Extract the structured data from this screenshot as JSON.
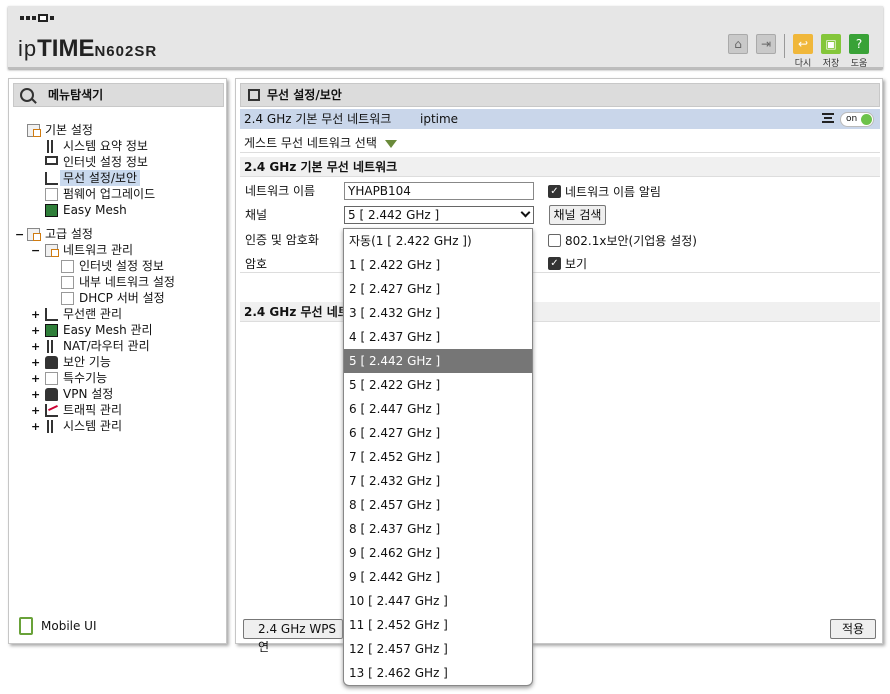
{
  "header": {
    "brand_pre": "ip",
    "brand_bold": "TIME",
    "model": "N602SR",
    "actions": [
      {
        "label": "다시",
        "icon": "undo-icon"
      },
      {
        "label": "저장",
        "icon": "save-icon"
      },
      {
        "label": "도움",
        "icon": "help-icon"
      }
    ],
    "accent": "#84c63a"
  },
  "left": {
    "title": "메뉴탐색기",
    "mobile": "Mobile UI",
    "basic": {
      "label": "기본 설정",
      "items": [
        "시스템 요약 정보",
        "인터넷 설정 정보",
        "무선 설정/보안",
        "펌웨어 업그레이드",
        "Easy Mesh"
      ]
    },
    "advanced": {
      "label": "고급 설정",
      "network": "네트워크 관리",
      "network_sub": [
        "인터넷 설정 정보",
        "내부 네트워크 설정",
        "DHCP 서버 설정"
      ],
      "others": [
        "무선랜 관리",
        "Easy Mesh 관리",
        "NAT/라우터 관리",
        "보안 기능",
        "특수기능",
        "VPN 설정",
        "트래픽 관리",
        "시스템 관리"
      ]
    }
  },
  "main": {
    "title": "무선 설정/보안",
    "band_label": "2.4 GHz 기본 무선 네트워크",
    "band_ssid": "iptime",
    "toggle": "on",
    "guest": "게스트 무선 네트워크 선택",
    "section1": "2.4 GHz 기본 무선 네트워크",
    "name_label": "네트워크 이름",
    "name_value": "YHAPB104",
    "broadcast": "네트워크 이름 알림",
    "channel_label": "채널",
    "channel_value": "5 [ 2.442 GHz ]",
    "scan": "채널 검색",
    "auth_label": "인증 및 암호화",
    "dot1x": "802.1x보안(기업용 설정)",
    "pw_label": "암호",
    "show": "보기",
    "section2": "2.4 GHz 무선 네트",
    "wps": "2.4 GHz WPS연",
    "apply": "적용"
  },
  "dropdown": {
    "selected_index": 5,
    "options": [
      "자동(1 [ 2.422 GHz ])",
      "1 [ 2.422 GHz ]",
      "2 [ 2.427 GHz ]",
      "3 [ 2.432 GHz ]",
      "4 [ 2.437 GHz ]",
      "5 [ 2.442 GHz ]",
      "5 [ 2.422 GHz ]",
      "6 [ 2.447 GHz ]",
      "6 [ 2.427 GHz ]",
      "7 [ 2.452 GHz ]",
      "7 [ 2.432 GHz ]",
      "8 [ 2.457 GHz ]",
      "8 [ 2.437 GHz ]",
      "9 [ 2.462 GHz ]",
      "9 [ 2.442 GHz ]",
      "10 [ 2.447 GHz ]",
      "11 [ 2.452 GHz ]",
      "12 [ 2.457 GHz ]",
      "13 [ 2.462 GHz ]"
    ]
  }
}
